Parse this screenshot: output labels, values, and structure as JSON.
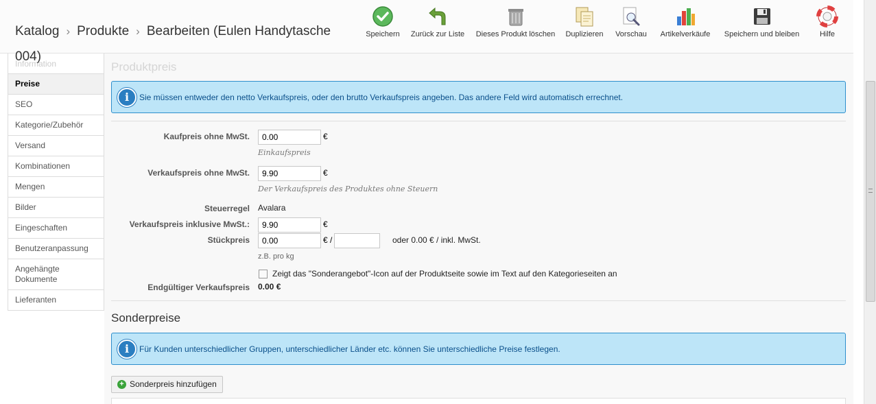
{
  "breadcrumb": {
    "items": [
      "Katalog",
      "Produkte",
      "Bearbeiten (Eulen Handytasche"
    ],
    "continuation": "004)",
    "separator": "›"
  },
  "toolbar": {
    "buttons": [
      {
        "label": "Speichern",
        "icon": "checkmark-icon"
      },
      {
        "label": "Zurück zur Liste",
        "icon": "back-arrow-icon"
      },
      {
        "label": "Dieses Produkt löschen",
        "icon": "trash-icon"
      },
      {
        "label": "Duplizieren",
        "icon": "duplicate-icon"
      },
      {
        "label": "Vorschau",
        "icon": "preview-icon"
      },
      {
        "label": "Artikelverkäufe",
        "icon": "bar-chart-icon"
      },
      {
        "label": "Speichern und bleiben",
        "icon": "floppy-disk-icon"
      },
      {
        "label": "Hilfe",
        "icon": "lifebuoy-icon"
      }
    ]
  },
  "tabs": {
    "items": [
      "Information",
      "Preise",
      "SEO",
      "Kategorie/Zubehör",
      "Versand",
      "Kombinationen",
      "Mengen",
      "Bilder",
      "Eingeschaften",
      "Benutzeranpassung",
      "Angehängte Dokumente",
      "Lieferanten"
    ],
    "active": "Preise"
  },
  "price": {
    "title": "Produktpreis",
    "info": "Sie müssen entweder den netto Verkaufspreis, oder den brutto Verkaufspreis angeben. Das andere Feld wird automatisch errechnet.",
    "purchase_label": "Kaufpreis ohne MwSt.",
    "purchase_value": "0.00",
    "purchase_hint": "Einkaufspreis",
    "sale_label": "Verkaufspreis ohne MwSt.",
    "sale_value": "9.90",
    "sale_hint": "Der Verkaufspreis des Produktes ohne Steuern",
    "tax_label": "Steuerregel",
    "tax_value": "Avalara",
    "incl_label": "Verkaufspreis inklusive MwSt.:",
    "incl_value": "9.90",
    "unit_label": "Stückpreis",
    "unit_value": "0.00",
    "unit_sep": "€ /",
    "unit_suffix_value": "",
    "unit_or": "oder 0.00 € / inkl. MwSt.",
    "unit_hint": "z.B. pro kg",
    "currency": "€",
    "special_checkbox_label": "Zeigt das \"Sonderangebot\"-Icon auf der Produktseite sowie im Text auf den Kategorieseiten an",
    "final_label": "Endgültiger Verkaufspreis",
    "final_value": "0.00 €"
  },
  "special": {
    "title": "Sonderpreise",
    "info": "Für Kunden unterschiedlicher Gruppen, unterschiedlicher Länder etc. können Sie unterschiedliche Preise festlegen.",
    "add_button": "Sonderpreis hinzufügen"
  },
  "colors": {
    "info_bg": "#bde5f8",
    "info_border": "#2d8ecc",
    "info_text": "#0a4f8a"
  }
}
